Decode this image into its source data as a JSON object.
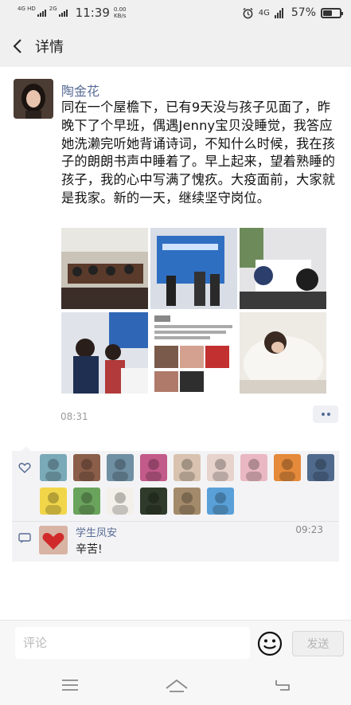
{
  "status_bar": {
    "network_1": "4G HD",
    "network_2": "2G",
    "time": "11:39",
    "speed_value": "0.00",
    "speed_unit": "KB/s",
    "alarm_icon": "alarm-clock-icon",
    "network_right": "4G",
    "battery_percent": "57%",
    "battery_level": 0.57
  },
  "header": {
    "back_icon": "chevron-left-icon",
    "title": "详情"
  },
  "post": {
    "author": "陶金花",
    "text": "同在一个屋檐下，已有9天没与孩子见面了，昨晚下了个早班，偶遇Jenny宝贝没睡觉，我答应她洗濑完听她背诵诗词，不知什么时候，我在孩子的朗朗书声中睡着了。早上起来，望着熟睡的孩子，我的心中写满了愧疚。大疫面前，大家就是我家。新的一天，继续坚守岗位。",
    "photo_count": 6,
    "time": "08:31",
    "more_icon": "more-dots-icon"
  },
  "likes": {
    "icon": "heart-outline-icon",
    "count": 15,
    "colors": [
      "#7aa9b8",
      "#8b5e4a",
      "#6f8fa3",
      "#c25a8a",
      "#d9c3b0",
      "#e7d2cc",
      "#eab8c2",
      "#e48a3a",
      "#4f6a8c",
      "#f1d64a",
      "#6aa35c",
      "#f3f0ea",
      "#2f3a2a",
      "#a38a6a",
      "#5aa0d8"
    ]
  },
  "comment": {
    "icon": "comment-bubble-icon",
    "author": "学生凤安",
    "time": "09:23",
    "text": "辛苦!"
  },
  "input_bar": {
    "placeholder": "评论",
    "emoji_icon": "smiley-face-icon",
    "send_label": "发送"
  },
  "system_nav": {
    "menu_icon": "menu-lines-icon",
    "home_icon": "home-icon",
    "back_icon": "back-arrow-icon"
  }
}
